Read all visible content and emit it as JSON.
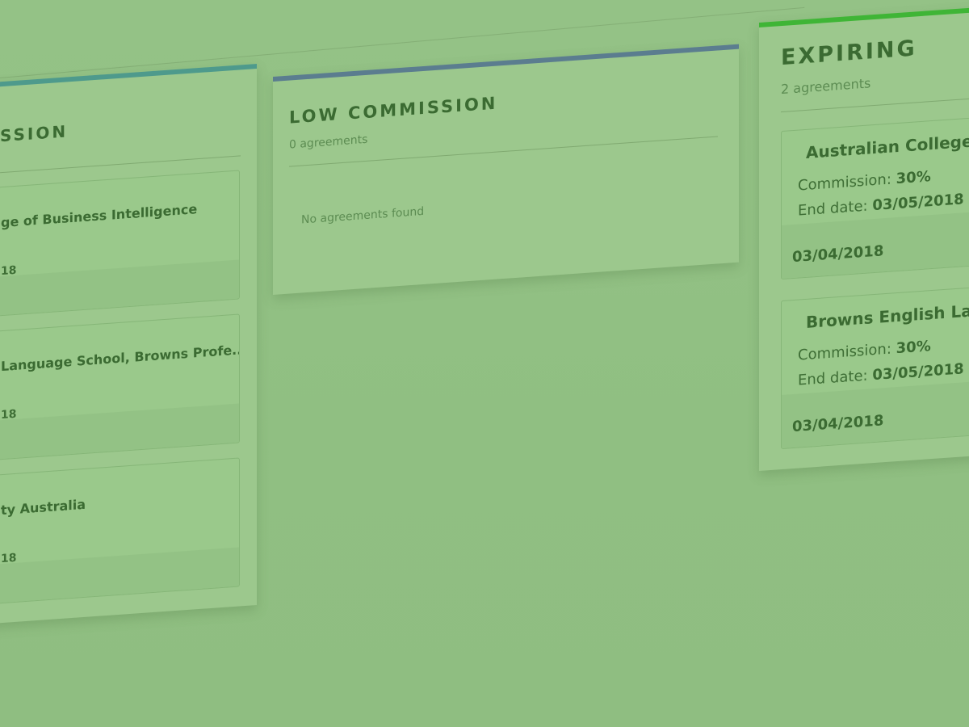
{
  "columns": {
    "left": {
      "title": "SSION",
      "accent": "#4e9a8c",
      "cards": [
        {
          "name": "ge of Business Intelligence",
          "date": "18"
        },
        {
          "name": "Language School, Browns Profe...",
          "date": "18"
        },
        {
          "name": "ty Australia",
          "date": "18"
        }
      ]
    },
    "low": {
      "title": "LOW COMMISSION",
      "count": "0 agreements",
      "empty_message": "No agreements found",
      "accent": "#5b7d8f"
    },
    "expiring": {
      "title": "EXPIRING",
      "count": "2 agreements",
      "accent": "#3fb536",
      "commission_label": "Commission:",
      "end_date_label": "End date:",
      "cards": [
        {
          "name": "Australian College o",
          "commission": "30%",
          "end_date": "03/05/2018",
          "footer_date": "03/04/2018"
        },
        {
          "name": "Browns English Lan",
          "commission": "30%",
          "end_date": "03/05/2018",
          "footer_date": "03/04/2018"
        }
      ]
    }
  }
}
